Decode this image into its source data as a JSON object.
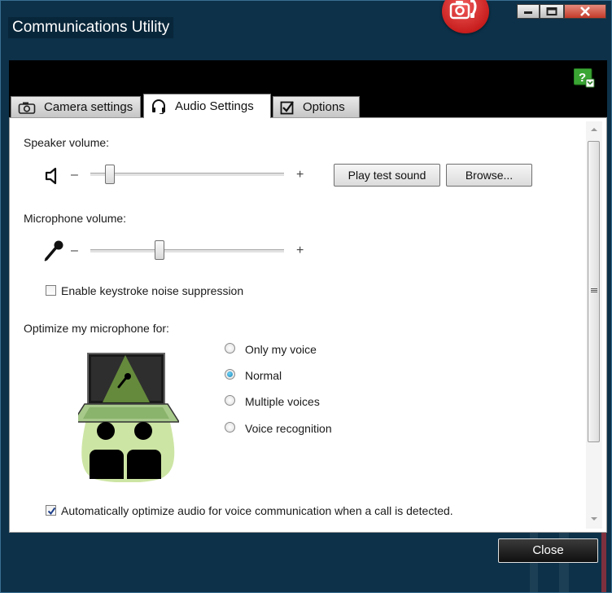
{
  "window": {
    "title": "Communications Utility"
  },
  "tabs": [
    {
      "label": "Camera settings",
      "icon": "camera-icon"
    },
    {
      "label": "Audio Settings",
      "icon": "headset-icon"
    },
    {
      "label": "Options",
      "icon": "checkbox-icon"
    }
  ],
  "speaker": {
    "label": "Speaker volume:",
    "minus": "–",
    "plus": "+",
    "level": 0.08,
    "play_test": "Play test sound",
    "browse": "Browse..."
  },
  "microphone": {
    "label": "Microphone volume:",
    "minus": "–",
    "plus": "+",
    "level": 0.35
  },
  "noise_suppression": {
    "label": "Enable keystroke noise suppression",
    "checked": false
  },
  "optimize": {
    "label": "Optimize my microphone for:",
    "options": [
      "Only my voice",
      "Normal",
      "Multiple voices",
      "Voice recognition"
    ],
    "selected": "Normal"
  },
  "auto_optimize": {
    "label": "Automatically optimize audio for voice communication when a call is detected.",
    "checked": true
  },
  "footer": {
    "close": "Close"
  },
  "colors": {
    "accent": "#1a86b8",
    "title_bg": "#0c3149",
    "badge": "#c81e1e",
    "illustration_green": "#c8e39a"
  }
}
